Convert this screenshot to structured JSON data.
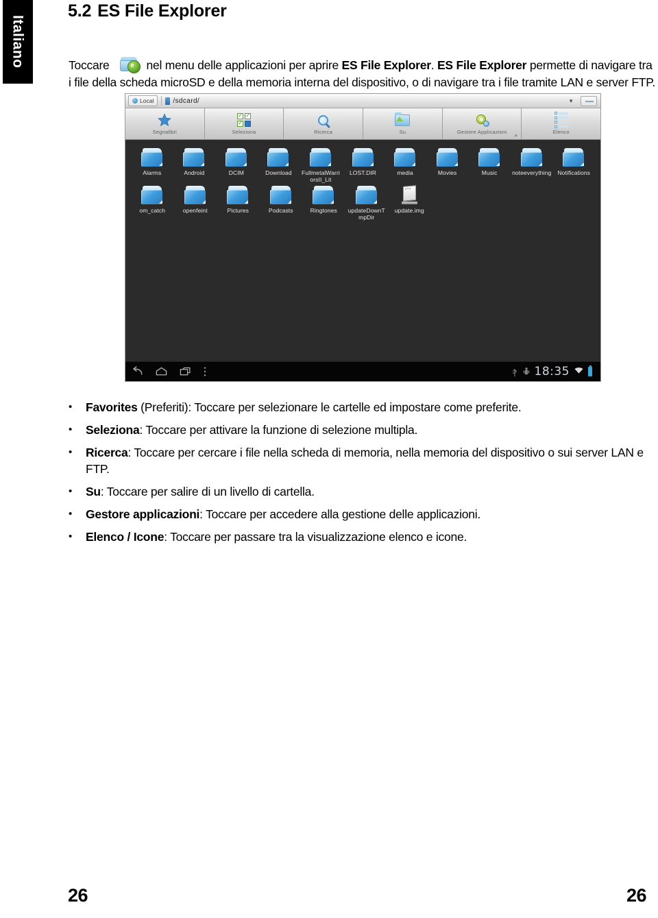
{
  "language_tab": {
    "label": "Italiano"
  },
  "heading": {
    "number": "5.2",
    "title": "ES File Explorer"
  },
  "intro": {
    "part1": "Toccare",
    "icon": "es-file-explorer-icon",
    "part2": "nel menu delle applicazioni per aprire ",
    "bold1": "ES File Explorer",
    "part3": ". ",
    "bold2": "ES File Explorer",
    "part4": " permette di navigare tra i file della scheda microSD e della memoria interna del dispositivo, o di navigare tra i file tramite LAN e server FTP."
  },
  "screenshot": {
    "address_bar": {
      "local_label": "Local",
      "path": "/sdcard/",
      "dropdown_icon": "chevron-down-icon",
      "minimize_icon": "minimize-icon"
    },
    "toolbar": [
      {
        "label": "Segnalibri",
        "icon": "star-icon"
      },
      {
        "label": "Seleziona",
        "icon": "multi-select-icon"
      },
      {
        "label": "Ricerca",
        "icon": "search-icon"
      },
      {
        "label": "Su",
        "icon": "up-folder-icon"
      },
      {
        "label": "Gestore Applicazioni",
        "icon": "app-manager-gear-icon"
      },
      {
        "label": "Elenco",
        "icon": "list-view-icon"
      }
    ],
    "files_row1": [
      {
        "name": "Alarms",
        "type": "folder"
      },
      {
        "name": "Android",
        "type": "folder"
      },
      {
        "name": "DCIM",
        "type": "folder"
      },
      {
        "name": "Download",
        "type": "folder"
      },
      {
        "name": "FullmetalWarriorsII_Lit",
        "type": "folder"
      },
      {
        "name": "LOST.DIR",
        "type": "folder"
      },
      {
        "name": "media",
        "type": "folder"
      },
      {
        "name": "Movies",
        "type": "folder"
      },
      {
        "name": "Music",
        "type": "folder"
      },
      {
        "name": "noteeverything",
        "type": "folder"
      },
      {
        "name": "Notifications",
        "type": "folder"
      }
    ],
    "files_row2": [
      {
        "name": "om_catch",
        "type": "folder"
      },
      {
        "name": "openfeint",
        "type": "folder"
      },
      {
        "name": "Pictures",
        "type": "folder"
      },
      {
        "name": "Podcasts",
        "type": "folder"
      },
      {
        "name": "Ringtones",
        "type": "folder"
      },
      {
        "name": "updateDownTmpDir",
        "type": "folder"
      },
      {
        "name": "update.img",
        "type": "file"
      }
    ],
    "navbar": {
      "back_icon": "back-icon",
      "home_icon": "home-icon",
      "recents_icon": "recent-apps-icon",
      "menu_icon": "overflow-menu-icon",
      "usb_icon": "usb-icon",
      "android_icon": "android-debug-icon",
      "clock": "18:35",
      "wifi_icon": "wifi-icon",
      "battery_icon": "battery-icon"
    },
    "colors": {
      "background": "#2b2b2b",
      "navbar": "#050505",
      "folder_blue": "#3f9ddd",
      "clock_text": "#cfd8dd"
    }
  },
  "bullets": [
    {
      "bullet": "•",
      "term": "Favorites",
      "rest": " (Preferiti): Toccare per selezionare le cartelle ed impostare come preferite."
    },
    {
      "bullet": "•",
      "term": "Seleziona",
      "rest": ": Toccare per attivare la funzione di selezione multipla."
    },
    {
      "bullet": "•",
      "term": "Ricerca",
      "rest": ": Toccare per cercare i file nella scheda di memoria, nella memoria del dispositivo o sui server LAN e FTP."
    },
    {
      "bullet": "•",
      "term": "Su",
      "rest": ": Toccare per salire di un livello di cartella."
    },
    {
      "bullet": "•",
      "term": "Gestore applicazioni",
      "rest": ": Toccare per accedere alla gestione delle applicazioni."
    },
    {
      "bullet": "•",
      "term": "Elenco / Icone",
      "rest": ": Toccare per passare tra la visualizzazione elenco e icone."
    }
  ],
  "footer": {
    "page_left": "26",
    "page_right": "26"
  }
}
